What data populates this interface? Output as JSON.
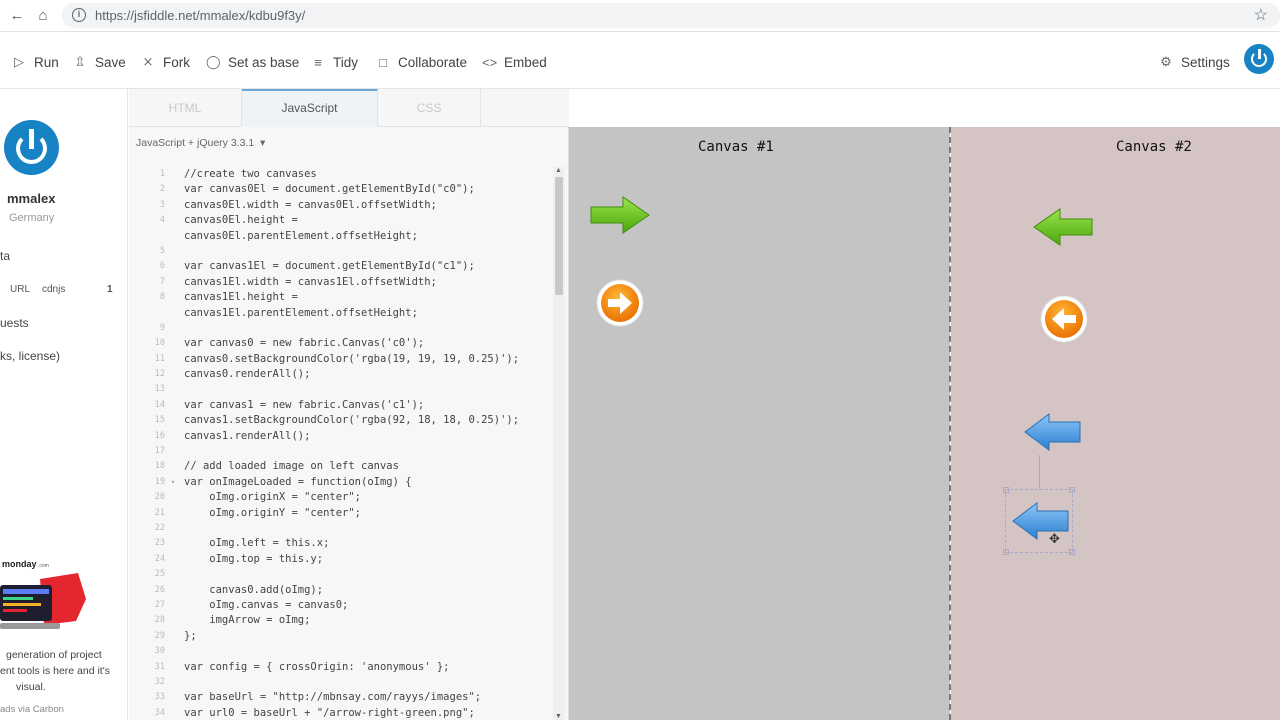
{
  "browser": {
    "url": "https://jsfiddle.net/mmalex/kdbu9f3y/",
    "back_icon": "arrow-left-icon",
    "home_icon": "home-icon",
    "star_icon": "star-icon"
  },
  "toolbar": {
    "run": "Run",
    "save": "Save",
    "fork": "Fork",
    "set_as_base": "Set as base",
    "tidy": "Tidy",
    "collaborate": "Collaborate",
    "embed": "Embed",
    "settings": "Settings"
  },
  "sidebar": {
    "username": "mmalex",
    "country": "Germany",
    "meta": "ta",
    "resources_url": "URL",
    "resources_cdnjs": "cdnjs",
    "resources_count": "1",
    "requests": "uests",
    "license": "ks, license)",
    "ad_brand": "monday",
    "ad_brand_suffix": ".com",
    "ad_line1": "generation of project",
    "ad_line2": "ent tools is here and it's",
    "ad_line3": "visual.",
    "ad_footer": "ads via Carbon"
  },
  "tabs": [
    "HTML",
    "JavaScript",
    "CSS"
  ],
  "editor": {
    "language": "JavaScript + jQuery 3.3.1",
    "lines": [
      {
        "n": "1",
        "fold": "",
        "code": "//create two canvases"
      },
      {
        "n": "2",
        "fold": "",
        "code": "var canvas0El = document.getElementById(\"c0\");"
      },
      {
        "n": "3",
        "fold": "",
        "code": "canvas0El.width = canvas0El.offsetWidth;"
      },
      {
        "n": "4",
        "fold": "",
        "code": "canvas0El.height ="
      },
      {
        "n": "",
        "fold": "",
        "code": "canvas0El.parentElement.offsetHeight;"
      },
      {
        "n": "5",
        "fold": "",
        "code": ""
      },
      {
        "n": "6",
        "fold": "",
        "code": "var canvas1El = document.getElementById(\"c1\");"
      },
      {
        "n": "7",
        "fold": "",
        "code": "canvas1El.width = canvas1El.offsetWidth;"
      },
      {
        "n": "8",
        "fold": "",
        "code": "canvas1El.height ="
      },
      {
        "n": "",
        "fold": "",
        "code": "canvas1El.parentElement.offsetHeight;"
      },
      {
        "n": "9",
        "fold": "",
        "code": ""
      },
      {
        "n": "10",
        "fold": "",
        "code": "var canvas0 = new fabric.Canvas('c0');"
      },
      {
        "n": "11",
        "fold": "",
        "code": "canvas0.setBackgroundColor('rgba(19, 19, 19, 0.25)');"
      },
      {
        "n": "12",
        "fold": "",
        "code": "canvas0.renderAll();"
      },
      {
        "n": "13",
        "fold": "",
        "code": ""
      },
      {
        "n": "14",
        "fold": "",
        "code": "var canvas1 = new fabric.Canvas('c1');"
      },
      {
        "n": "15",
        "fold": "",
        "code": "canvas1.setBackgroundColor('rgba(92, 18, 18, 0.25)');"
      },
      {
        "n": "16",
        "fold": "",
        "code": "canvas1.renderAll();"
      },
      {
        "n": "17",
        "fold": "",
        "code": ""
      },
      {
        "n": "18",
        "fold": "",
        "code": "// add loaded image on left canvas"
      },
      {
        "n": "19",
        "fold": "▾",
        "code": "var onImageLoaded = function(oImg) {"
      },
      {
        "n": "20",
        "fold": "",
        "code": "    oImg.originX = \"center\";"
      },
      {
        "n": "21",
        "fold": "",
        "code": "    oImg.originY = \"center\";"
      },
      {
        "n": "22",
        "fold": "",
        "code": ""
      },
      {
        "n": "23",
        "fold": "",
        "code": "    oImg.left = this.x;"
      },
      {
        "n": "24",
        "fold": "",
        "code": "    oImg.top = this.y;"
      },
      {
        "n": "25",
        "fold": "",
        "code": ""
      },
      {
        "n": "26",
        "fold": "",
        "code": "    canvas0.add(oImg);"
      },
      {
        "n": "27",
        "fold": "",
        "code": "    oImg.canvas = canvas0;"
      },
      {
        "n": "28",
        "fold": "",
        "code": "    imgArrow = oImg;"
      },
      {
        "n": "29",
        "fold": "",
        "code": "};"
      },
      {
        "n": "30",
        "fold": "",
        "code": ""
      },
      {
        "n": "31",
        "fold": "",
        "code": "var config = { crossOrigin: 'anonymous' };"
      },
      {
        "n": "32",
        "fold": "",
        "code": ""
      },
      {
        "n": "33",
        "fold": "",
        "code": "var baseUrl = \"http://mbnsay.com/rayys/images\";"
      },
      {
        "n": "34",
        "fold": "",
        "code": "var url0 = baseUrl + \"/arrow-right-green.png\";"
      }
    ]
  },
  "result": {
    "canvas0_title": "Canvas #1",
    "canvas1_title": "Canvas #2"
  },
  "colors": {
    "canvas0_bg": "#c4c4c4",
    "canvas1_bg": "#d5c4c4",
    "accent": "#1782c4",
    "green_arrow": "#6cc416",
    "orange_circle": "#f58a07",
    "blue_arrow": "#3d94dd"
  }
}
